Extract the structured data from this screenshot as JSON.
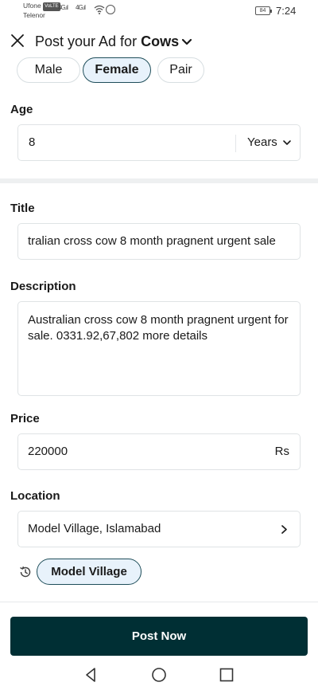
{
  "status_bar": {
    "carrier_1": "Ufone",
    "carrier_1_badge": "VoLTE",
    "carrier_2": "Telenor",
    "signal_1": "4G",
    "signal_2": "4G",
    "battery": "84",
    "time": "7:24"
  },
  "header": {
    "title_prefix": "Post your Ad for",
    "category": "Cows"
  },
  "gender": {
    "options": [
      "Male",
      "Female",
      "Pair"
    ],
    "selected": "Female"
  },
  "age": {
    "label": "Age",
    "value": "8",
    "unit": "Years"
  },
  "title": {
    "label": "Title",
    "value": "tralian cross cow  8 month pragnent  urgent sale"
  },
  "description": {
    "label": "Description",
    "value": "Australian cross cow 8 month pragnent urgent for sale. 0331.92,67,802 more details"
  },
  "price": {
    "label": "Price",
    "value": "220000",
    "currency": "Rs"
  },
  "location": {
    "label": "Location",
    "value": "Model Village, Islamabad",
    "recent": "Model Village"
  },
  "actions": {
    "post_label": "Post Now"
  },
  "colors": {
    "primary": "#002f34",
    "selected_bg": "#e8f2fb",
    "selected_border": "#1f4e5a"
  }
}
